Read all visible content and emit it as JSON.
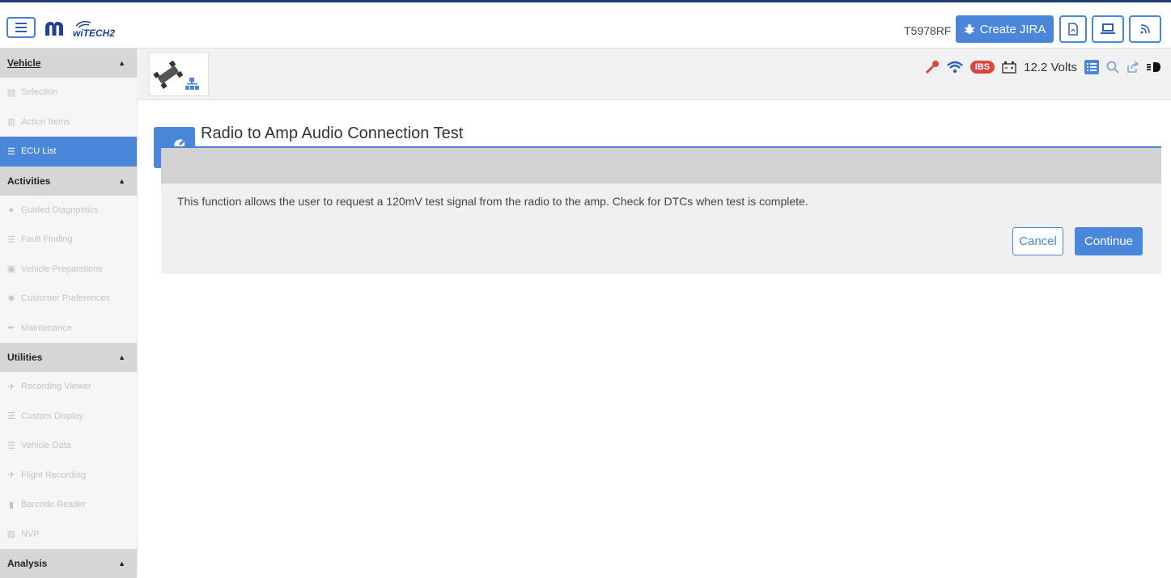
{
  "header": {
    "vin": "T5978RF",
    "create_jira_label": "Create JIRA",
    "logo_text": "wiTECH2"
  },
  "sidebar": {
    "sections": [
      {
        "title": "Vehicle",
        "items": [
          {
            "label": "Selection",
            "icon": "car-icon"
          },
          {
            "label": "Action Items",
            "icon": "sitemap-icon"
          },
          {
            "label": "ECU List",
            "icon": "list-icon",
            "active": true
          }
        ]
      },
      {
        "title": "Activities",
        "items": [
          {
            "label": "Guided Diagnostics",
            "icon": "gear-icon"
          },
          {
            "label": "Fault Finding",
            "icon": "list-icon"
          },
          {
            "label": "Vehicle Preparations",
            "icon": "briefcase-icon"
          },
          {
            "label": "Customer Preferences",
            "icon": "user-icon"
          },
          {
            "label": "Maintenance",
            "icon": "wrench-icon"
          }
        ]
      },
      {
        "title": "Utilities",
        "items": [
          {
            "label": "Recording Viewer",
            "icon": "plane-icon"
          },
          {
            "label": "Custom Display",
            "icon": "list-icon"
          },
          {
            "label": "Vehicle Data",
            "icon": "list-icon"
          },
          {
            "label": "Flight Recording",
            "icon": "plane-icon"
          },
          {
            "label": "Barcode Reader",
            "icon": "barcode-icon"
          },
          {
            "label": "NVP",
            "icon": "car-icon"
          }
        ]
      },
      {
        "title": "Analysis",
        "items": []
      }
    ]
  },
  "status": {
    "ibs_label": "IBS",
    "voltage": "12.2 Volts"
  },
  "main": {
    "title": "Radio to Amp Audio Connection Test",
    "description": "This function allows the user to request a 120mV test signal from the radio to the amp. Check for DTCs when test is complete.",
    "cancel_label": "Cancel",
    "continue_label": "Continue"
  },
  "colors": {
    "accent": "#4a86d9",
    "ibs_red": "#d9463e",
    "key_red": "#d9463e"
  }
}
